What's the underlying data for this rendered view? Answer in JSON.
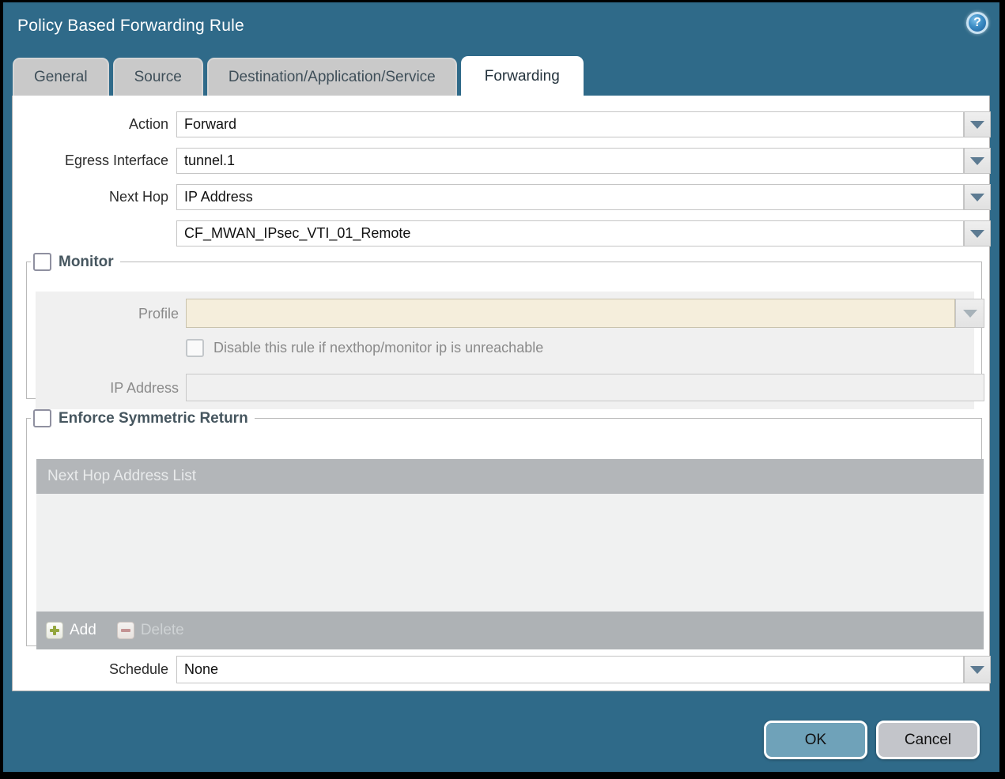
{
  "dialog": {
    "title": "Policy Based Forwarding Rule",
    "help_glyph": "?"
  },
  "tabs": [
    {
      "label": "General",
      "active": false
    },
    {
      "label": "Source",
      "active": false
    },
    {
      "label": "Destination/Application/Service",
      "active": false
    },
    {
      "label": "Forwarding",
      "active": true
    }
  ],
  "form": {
    "action": {
      "label": "Action",
      "value": "Forward"
    },
    "egress_interface": {
      "label": "Egress Interface",
      "value": "tunnel.1"
    },
    "next_hop": {
      "label": "Next Hop",
      "value": "IP Address"
    },
    "next_hop_address": {
      "value": "CF_MWAN_IPsec_VTI_01_Remote"
    },
    "schedule": {
      "label": "Schedule",
      "value": "None"
    }
  },
  "monitor": {
    "title": "Monitor",
    "checked": false,
    "profile": {
      "label": "Profile",
      "value": ""
    },
    "disable_rule": {
      "label": "Disable this rule if nexthop/monitor ip is unreachable",
      "checked": false
    },
    "ip_address": {
      "label": "IP Address",
      "value": ""
    }
  },
  "enforce_symmetric_return": {
    "title": "Enforce Symmetric Return",
    "checked": false,
    "table": {
      "header": "Next Hop Address List",
      "rows": []
    },
    "add_label": "Add",
    "delete_label": "Delete"
  },
  "footer": {
    "ok_label": "OK",
    "cancel_label": "Cancel"
  },
  "colors": {
    "dialog_background": "#2f6a89",
    "inactive_tab": "#c9c9c9",
    "active_tab": "#ffffff",
    "section_title_text": "#46565f",
    "table_header": "#b3b6b9",
    "table_footer": "#aeb2b5",
    "disabled_field_cream": "#f5eedc",
    "disabled_panel_gray": "#f0f0f0",
    "dropdown_arrow": "#5d7b92",
    "ok_button": "#6fa2b9",
    "cancel_button": "#c3c5ca",
    "add_icon_green": "#94a73d",
    "delete_icon_red": "#c49393"
  }
}
